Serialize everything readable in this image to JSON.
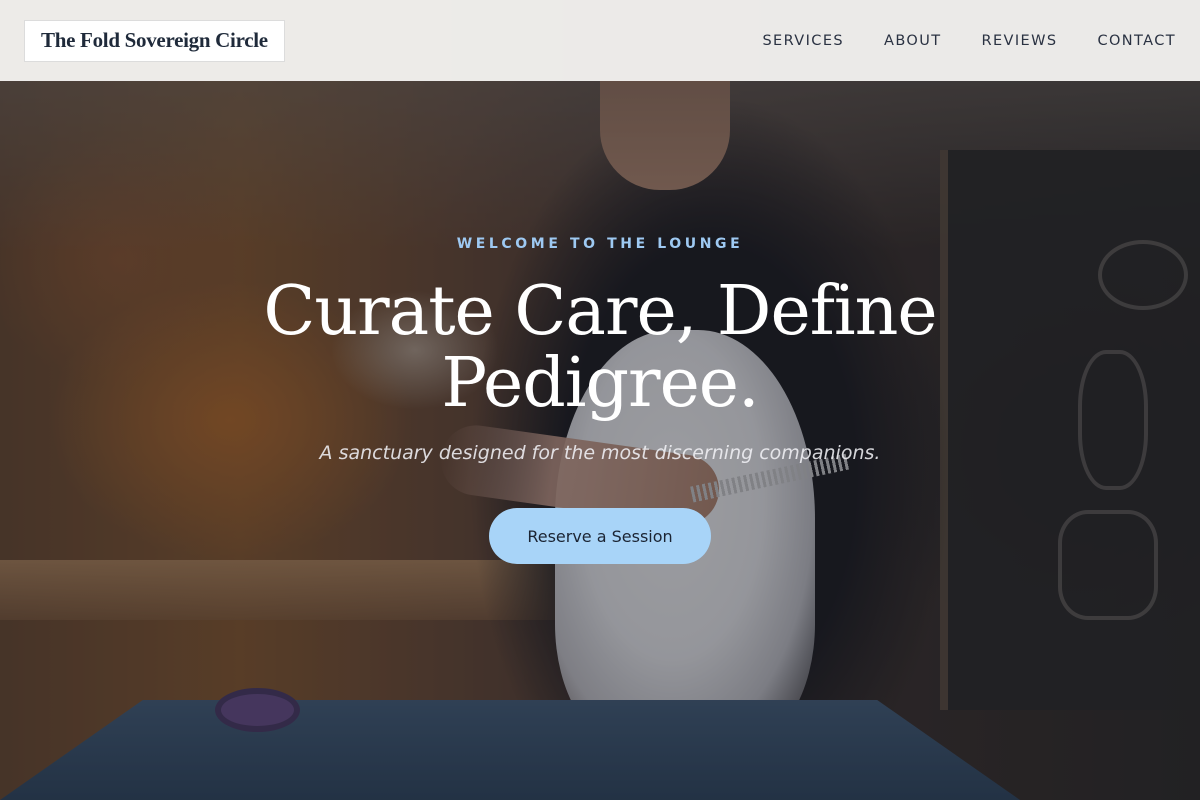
{
  "navbar": {
    "brand": "The Fold Sovereign Circle",
    "links": [
      {
        "label": "SERVICES"
      },
      {
        "label": "ABOUT"
      },
      {
        "label": "REVIEWS"
      },
      {
        "label": "CONTACT"
      }
    ]
  },
  "hero": {
    "eyebrow": "WELCOME TO THE LOUNGE",
    "headline": "Curate Care, Define Pedigree.",
    "subhead": "A sanctuary designed for the most discerning companions.",
    "cta_label": "Reserve a Session",
    "background_image": "groomer brushing white spitz dog on grooming table",
    "colors": {
      "eyebrow": "#9ec9f2",
      "cta_background": "#a8d4f8",
      "headline": "#ffffff"
    }
  }
}
